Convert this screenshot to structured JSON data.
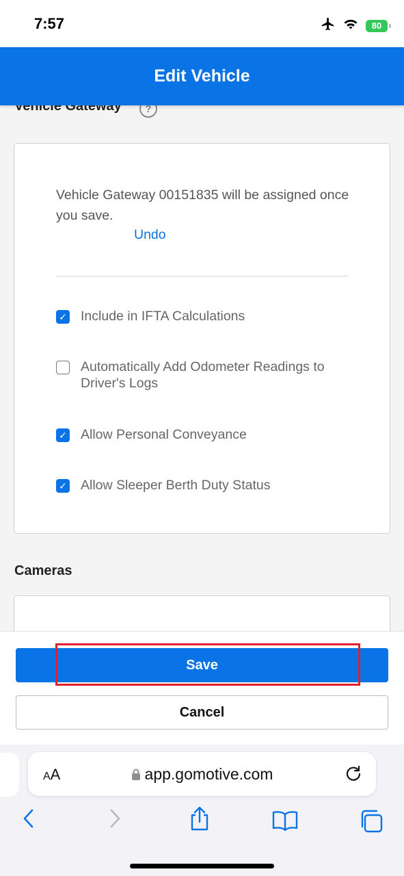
{
  "status_bar": {
    "time": "7:57",
    "battery": "80"
  },
  "header": {
    "title": "Edit Vehicle"
  },
  "vehicle_gateway": {
    "section_title": "Vehicle Gateway",
    "help": "?",
    "message": "Vehicle Gateway 00151835 will be assigned once you save.",
    "undo_label": "Undo",
    "options": [
      {
        "label": "Include in IFTA Calculations",
        "checked": true
      },
      {
        "label": "Automatically Add Odometer Readings to Driver's Logs",
        "checked": false
      },
      {
        "label": "Allow Personal Conveyance",
        "checked": true
      },
      {
        "label": "Allow Sleeper Berth Duty Status",
        "checked": true
      }
    ]
  },
  "cameras": {
    "section_title": "Cameras"
  },
  "actions": {
    "save_label": "Save",
    "cancel_label": "Cancel"
  },
  "browser": {
    "text_size_label_small": "A",
    "text_size_label_large": "A",
    "url": "app.gomotive.com"
  },
  "colors": {
    "primary": "#0a73e6",
    "highlight": "#e0202c",
    "battery": "#34c759"
  }
}
